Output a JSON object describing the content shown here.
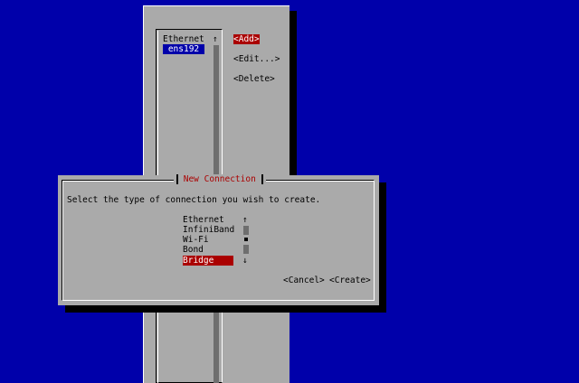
{
  "background_window": {
    "list": {
      "category": "Ethernet",
      "selected_item": "ens192",
      "scroll_up_arrow": "↑"
    },
    "buttons": {
      "add": "<Add>",
      "edit": "<Edit...>",
      "delete": "<Delete>"
    }
  },
  "dialog": {
    "title": "New Connection",
    "prompt": "Select the type of connection you wish to create.",
    "types": [
      "Ethernet",
      "InfiniBand",
      "Wi-Fi",
      "Bond",
      "Bridge"
    ],
    "selected_type": "Bridge",
    "scroll_up_arrow": "↑",
    "scroll_down_arrow": "↓",
    "cancel_label": "<Cancel>",
    "create_label": "<Create>"
  },
  "colors": {
    "screen_bg": "#0000aa",
    "window_bg": "#aaaaaa",
    "selection_red": "#aa0000",
    "selection_blue": "#0000aa",
    "shadow": "#000000"
  }
}
